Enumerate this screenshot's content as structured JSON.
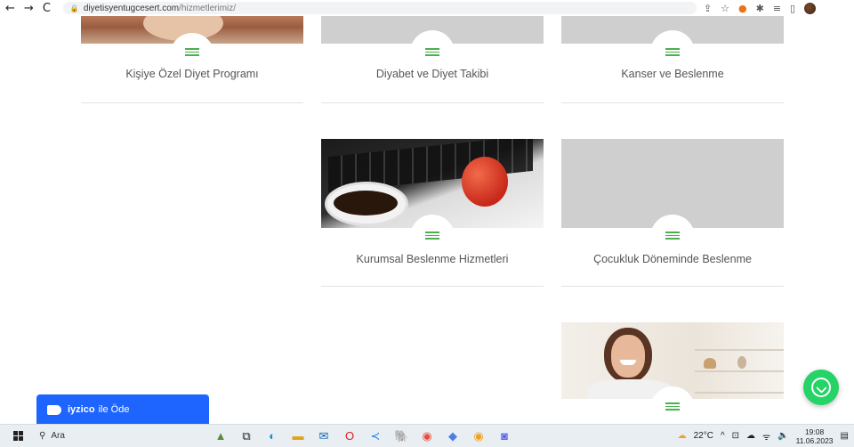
{
  "browser": {
    "back": "←",
    "forward": "→",
    "reload": "C",
    "url_domain": "diyetisyentugcesert.com",
    "url_path": "/hizmetlerimiz/"
  },
  "services": [
    {
      "title": "Kişiye Özel Diyet Programı"
    },
    {
      "title": "Diyabet ve Diyet Takibi"
    },
    {
      "title": "Kanser ve Beslenme"
    },
    {
      "title": "Kurumsal Beslenme Hizmetleri"
    },
    {
      "title": "Çocukluk Döneminde Beslenme"
    },
    {
      "title": ""
    }
  ],
  "iyzico": {
    "brand": "iyzico",
    "label": "ile Öde"
  },
  "taskbar": {
    "search_placeholder": "Ara",
    "weather": "22°C",
    "time": "19:08",
    "date": "11.06.2023"
  },
  "colors": {
    "accent_green": "#4caf50",
    "whatsapp": "#25d366",
    "iyzico_blue": "#1e64ff"
  }
}
